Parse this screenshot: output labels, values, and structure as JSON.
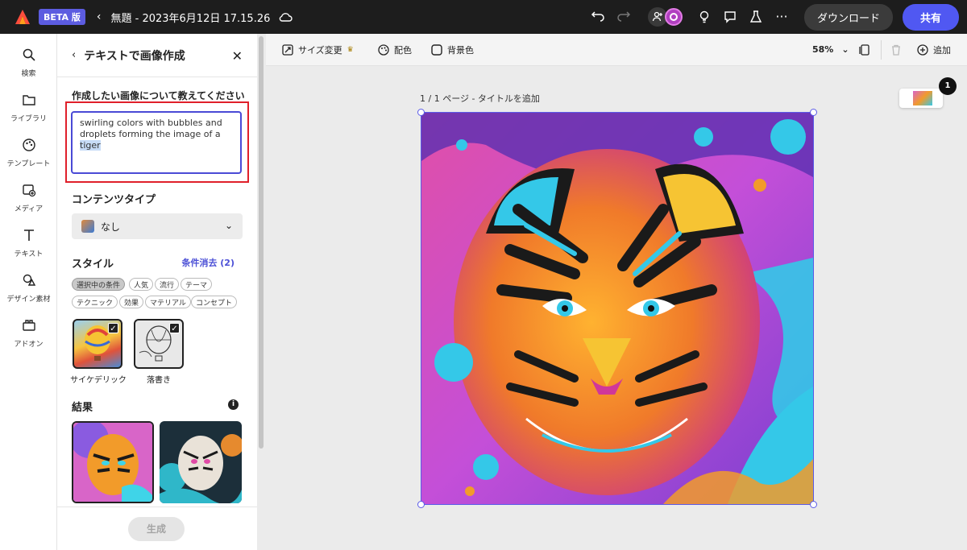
{
  "topbar": {
    "beta_label": "BETA 版",
    "doc_title": "無題 - 2023年6月12日 17.15.26",
    "download_label": "ダウンロード",
    "share_label": "共有"
  },
  "rail": {
    "items": [
      {
        "label": "検索",
        "icon": "search-icon"
      },
      {
        "label": "ライブラリ",
        "icon": "folder-icon"
      },
      {
        "label": "テンプレート",
        "icon": "template-icon"
      },
      {
        "label": "メディア",
        "icon": "media-icon"
      },
      {
        "label": "テキスト",
        "icon": "text-icon"
      },
      {
        "label": "デザイン素材",
        "icon": "shapes-icon"
      },
      {
        "label": "アドオン",
        "icon": "addon-icon"
      }
    ]
  },
  "panel": {
    "title": "テキストで画像作成",
    "prompt_label": "作成したい画像について教えてください",
    "prompt_text": "swirling colors with bubbles and droplets forming the image of a ",
    "prompt_selected": "tiger",
    "content_type_label": "コンテンツタイプ",
    "content_type_value": "なし",
    "style_label": "スタイル",
    "clear_filters": "条件消去 (2)",
    "chips": [
      "選択中の条件",
      "人気",
      "流行",
      "テーマ",
      "テクニック",
      "効果",
      "マテリアル",
      "コンセプト"
    ],
    "styles": [
      {
        "name": "サイケデリック",
        "checked": true
      },
      {
        "name": "落書き",
        "checked": true
      }
    ],
    "results_label": "結果",
    "generate_label": "生成"
  },
  "toolbar": {
    "resize_label": "サイズ変更",
    "color_label": "配色",
    "bg_label": "背景色",
    "zoom": "58%",
    "add_label": "追加"
  },
  "canvas": {
    "page_label": "1 / 1 ページ - タイトルを追加",
    "page_count_badge": "1"
  },
  "colors": {
    "accent": "#5058f2",
    "selection": "#5b5be8",
    "highlight_box": "#e0202a"
  }
}
